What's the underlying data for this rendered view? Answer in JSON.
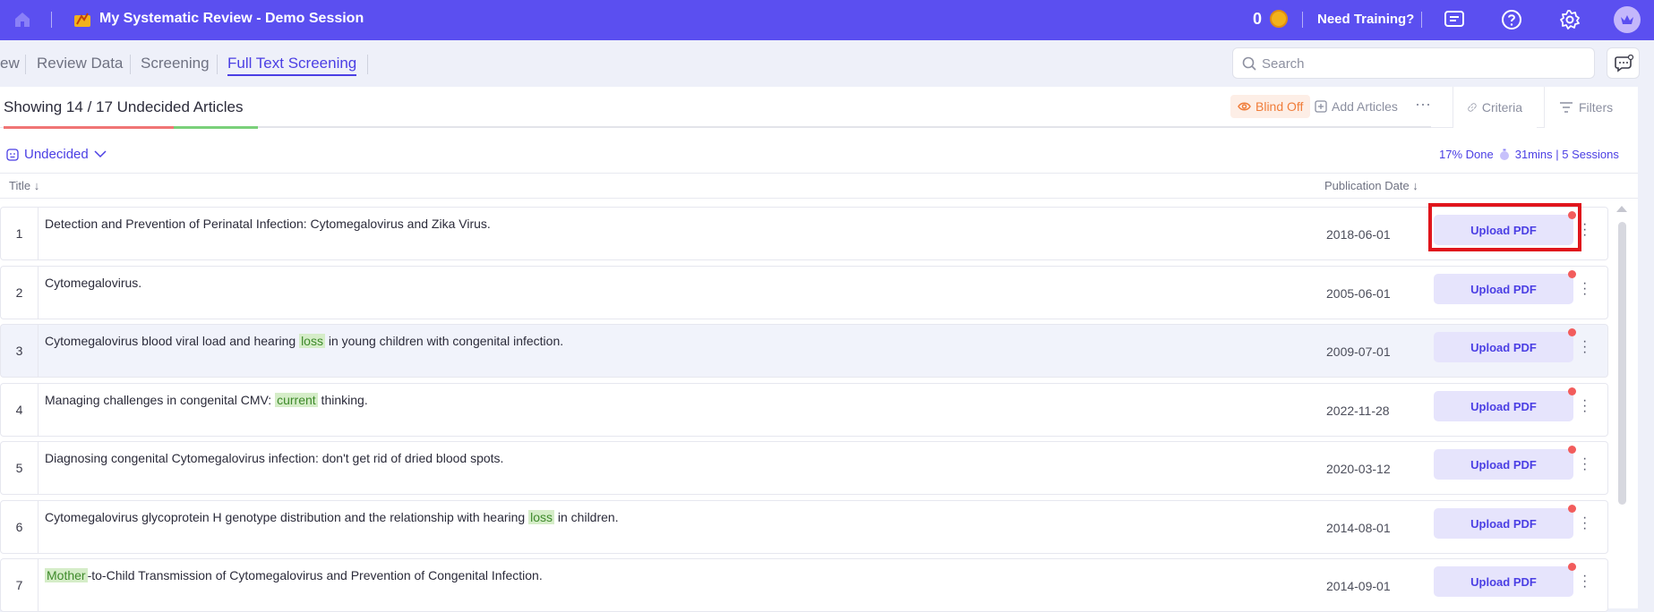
{
  "topbar": {
    "title": "My Systematic Review - Demo Session",
    "coins": "0",
    "training": "Need Training?",
    "bg_color": "#5b4ff0"
  },
  "nav": {
    "tabs": [
      {
        "label": "ew"
      },
      {
        "label": "Review Data"
      },
      {
        "label": "Screening"
      },
      {
        "label": "Full Text Screening",
        "active": true
      }
    ],
    "search_placeholder": "Search"
  },
  "toolbar": {
    "showing": "Showing 14 / 17 Undecided Articles",
    "blind": "Blind Off",
    "add_articles": "Add Articles",
    "criteria": "Criteria",
    "filters": "Filters"
  },
  "status": {
    "filter": "Undecided",
    "done": "17% Done",
    "time": "31mins | 5 Sessions"
  },
  "columns": {
    "title": "Title",
    "date": "Publication Date"
  },
  "upload_label": "Upload PDF",
  "articles": [
    {
      "num": "1",
      "pre": "Detection and Prevention of Perinatal Infection: Cytomegalovirus and Zika Virus.",
      "hl": "",
      "post": "",
      "date": "2018-06-01"
    },
    {
      "num": "2",
      "pre": "Cytomegalovirus.",
      "hl": "",
      "post": "",
      "date": "2005-06-01"
    },
    {
      "num": "3",
      "pre": "Cytomegalovirus blood viral load and hearing ",
      "hl": "loss",
      "post": " in young children with congenital infection.",
      "date": "2009-07-01"
    },
    {
      "num": "4",
      "pre": "Managing challenges in congenital CMV: ",
      "hl": "current",
      "post": " thinking.",
      "date": "2022-11-28"
    },
    {
      "num": "5",
      "pre": "Diagnosing congenital Cytomegalovirus infection: don't get rid of dried blood spots.",
      "hl": "",
      "post": "",
      "date": "2020-03-12"
    },
    {
      "num": "6",
      "pre": "Cytomegalovirus glycoprotein H genotype distribution and the relationship with hearing ",
      "hl": "loss",
      "post": " in children.",
      "date": "2014-08-01"
    },
    {
      "num": "7",
      "pre": "",
      "hl": "Mother",
      "post": "-to-Child Transmission of Cytomegalovirus and Prevention of Congenital Infection.",
      "date": "2014-09-01"
    }
  ]
}
